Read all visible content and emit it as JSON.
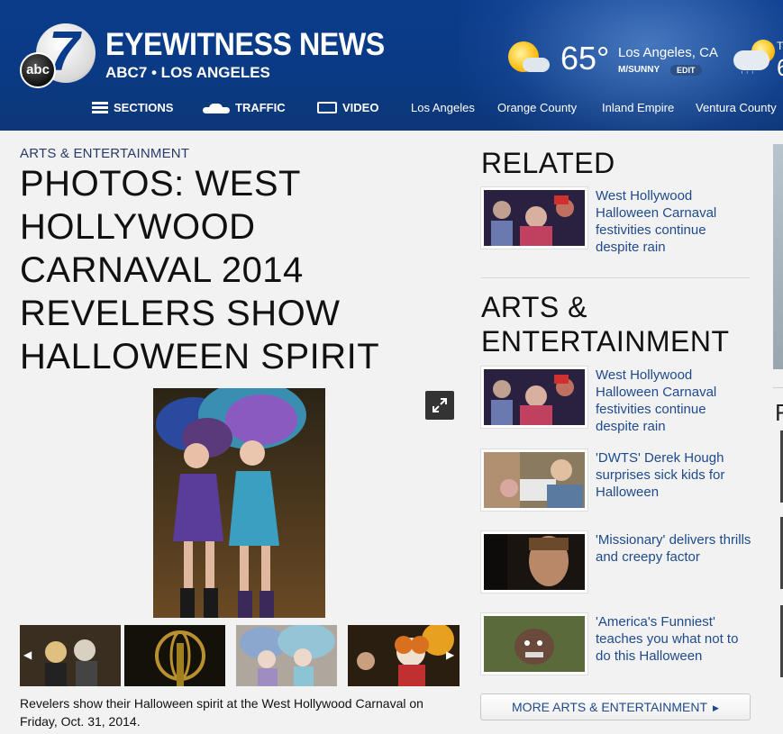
{
  "header": {
    "brand_title": "EYEWITNESS NEWS",
    "brand_sub": "ABC7 • LOS ANGELES",
    "logo_abc": "abc",
    "logo_seven": "7",
    "weather": {
      "temp": "65°",
      "location": "Los Angeles, CA",
      "condition": "M/SUNNY",
      "edit_label": "EDIT",
      "icon": "partly-sunny-icon",
      "next_icon": "rain-sun-icon",
      "next_label": "T",
      "next_temp": "6"
    },
    "nav": {
      "sections": "SECTIONS",
      "traffic": "TRAFFIC",
      "video": "VIDEO",
      "los_angeles": "Los Angeles",
      "orange_county": "Orange County",
      "inland_empire": "Inland Empire",
      "ventura_county": "Ventura County"
    }
  },
  "article": {
    "category": "ARTS & ENTERTAINMENT",
    "headline": "PHOTOS: WEST HOLLYWOOD CARNAVAL 2014 REVELERS SHOW HALLOWEEN SPIRIT",
    "caption": "Revelers show their Halloween spirit at the West Hollywood Carnaval on Friday, Oct. 31, 2014."
  },
  "sidebar": {
    "related_title": "RELATED",
    "related_items": [
      {
        "title": "West Hollywood Halloween Carnaval festivities continue despite rain"
      }
    ],
    "arts_title": "ARTS & ENTERTAINMENT",
    "arts_items": [
      {
        "title": "West Hollywood Halloween Carnaval festivities continue despite rain"
      },
      {
        "title": "'DWTS' Derek Hough surprises sick kids for Halloween"
      },
      {
        "title": "'Missionary' delivers thrills and creepy factor"
      },
      {
        "title": "'America's Funniest' teaches you what not to do this Halloween"
      }
    ],
    "more_label": "MORE ARTS & ENTERTAINMENT"
  },
  "edge": {
    "letter": "F"
  },
  "colors": {
    "header_blue": "#0b3c8c",
    "link_blue": "#1f4a8c",
    "category_blue": "#2a3a6a"
  }
}
